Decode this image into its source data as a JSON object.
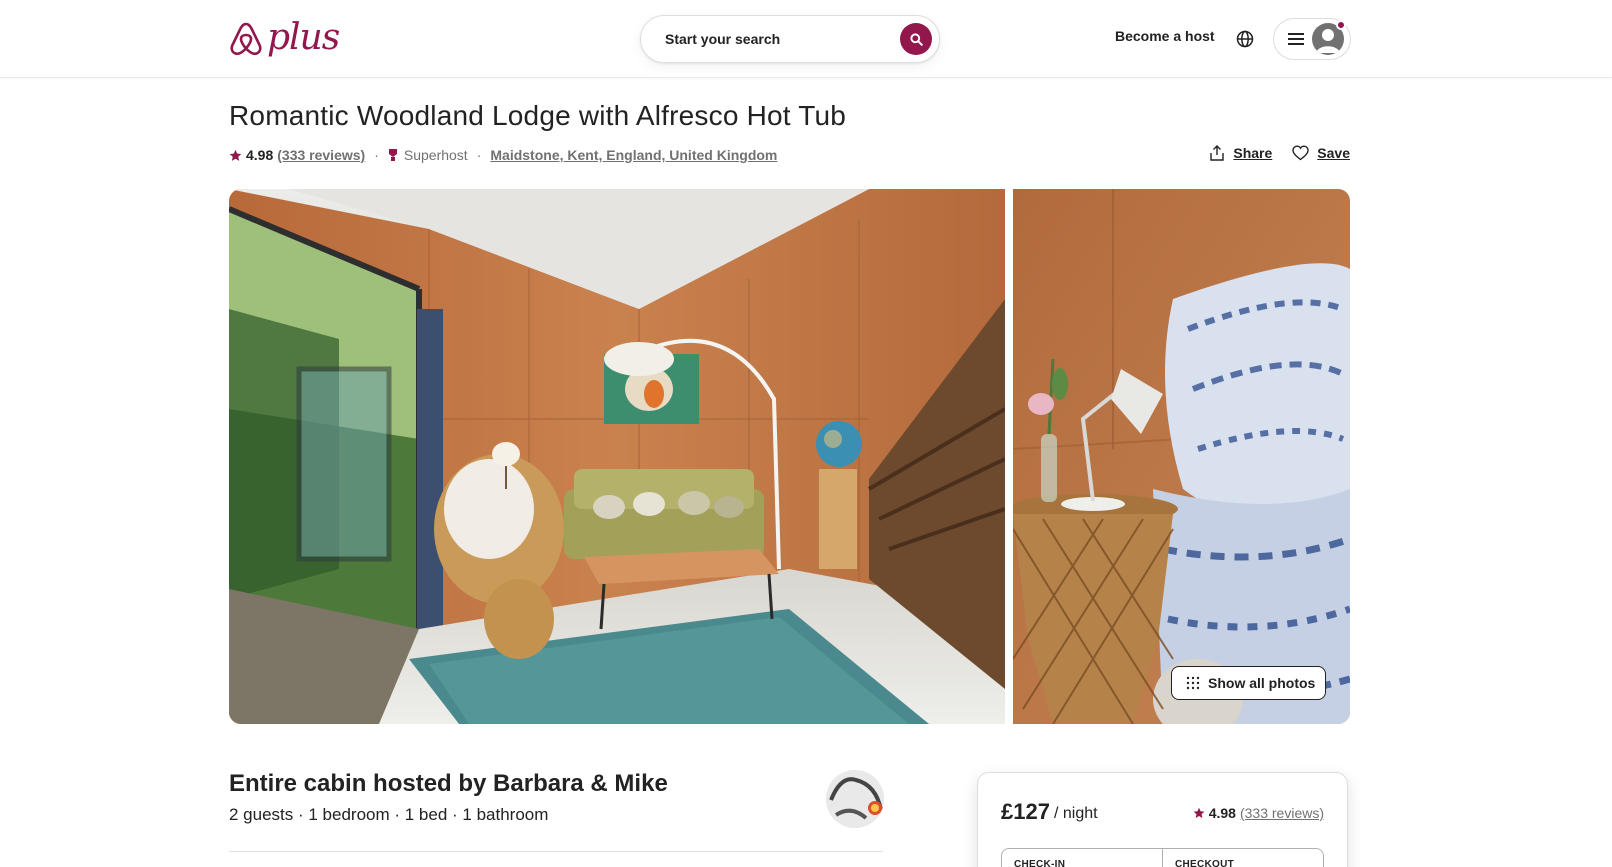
{
  "header": {
    "brand": "plus",
    "search_label": "Start your search",
    "host_link": "Become a host"
  },
  "listing": {
    "title": "Romantic Woodland Lodge with Alfresco Hot Tub",
    "rating": "4.98",
    "reviews_link": "(333 reviews)",
    "superhost": "Superhost",
    "location": "Maidstone, Kent, England, United Kingdom",
    "share_label": "Share",
    "save_label": "Save",
    "show_all_photos": "Show all photos",
    "host_title": "Entire cabin hosted by Barbara & Mike",
    "host_details": "2 guests · 1 bedroom · 1 bed · 1 bathroom"
  },
  "booking": {
    "price": "£127",
    "per_night": "/ night",
    "rating": "4.98",
    "reviews_link": "(333 reviews)",
    "checkin_label": "CHECK-IN",
    "checkout_label": "CHECKOUT"
  },
  "colors": {
    "brand_accent": "#92174d",
    "text_primary": "#222222",
    "text_secondary": "#717171",
    "border": "#dddddd"
  },
  "icons": {
    "logo": "airbnb-belo-icon",
    "search": "search-icon",
    "language": "globe-icon",
    "menu": "hamburger-icon",
    "profile": "user-avatar-icon",
    "rating": "star-icon",
    "superhost": "superhost-badge-icon",
    "share": "share-icon",
    "save": "heart-icon",
    "photos": "grid-dots-icon"
  }
}
